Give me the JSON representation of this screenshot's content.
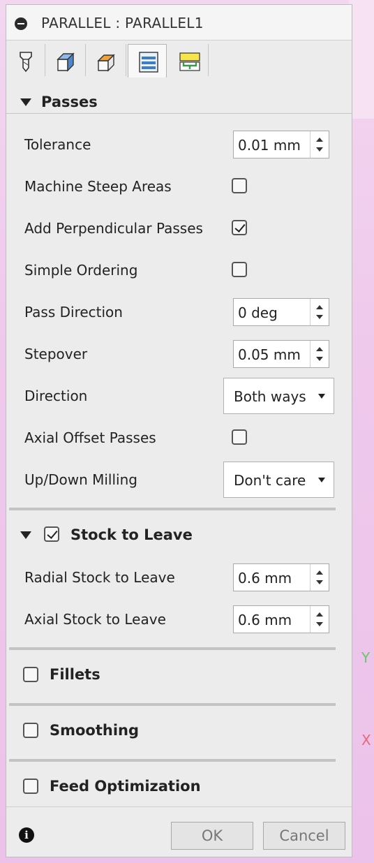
{
  "window": {
    "title": "PARALLEL : PARALLEL1"
  },
  "tabs": [
    {
      "icon": "tool-icon"
    },
    {
      "icon": "geometry-icon"
    },
    {
      "icon": "heights-icon"
    },
    {
      "icon": "passes-icon",
      "active": true
    },
    {
      "icon": "linking-icon"
    }
  ],
  "passes": {
    "header": "Passes",
    "tolerance": {
      "label": "Tolerance",
      "value": "0.01 mm"
    },
    "machine_steep_areas": {
      "label": "Machine Steep Areas",
      "checked": false
    },
    "add_perpendicular_passes": {
      "label": "Add Perpendicular Passes",
      "checked": true
    },
    "simple_ordering": {
      "label": "Simple Ordering",
      "checked": false
    },
    "pass_direction": {
      "label": "Pass Direction",
      "value": "0 deg"
    },
    "stepover": {
      "label": "Stepover",
      "value": "0.05 mm"
    },
    "direction": {
      "label": "Direction",
      "value": "Both ways"
    },
    "axial_offset_passes": {
      "label": "Axial Offset Passes",
      "checked": false
    },
    "up_down_milling": {
      "label": "Up/Down Milling",
      "value": "Don't care"
    }
  },
  "stock_to_leave": {
    "header": "Stock to Leave",
    "checked": true,
    "radial": {
      "label": "Radial Stock to Leave",
      "value": "0.6 mm"
    },
    "axial": {
      "label": "Axial Stock to Leave",
      "value": "0.6 mm"
    }
  },
  "fillets": {
    "header": "Fillets",
    "checked": false
  },
  "smoothing": {
    "header": "Smoothing",
    "checked": false
  },
  "feed_optimization": {
    "header": "Feed Optimization",
    "checked": false
  },
  "footer": {
    "ok_label": "OK",
    "cancel_label": "Cancel"
  },
  "viewport": {
    "axis_y": "Y",
    "axis_x": "X"
  },
  "colors": {
    "panel_bg": "#ececec",
    "canvas_bg": "#efc9ec",
    "button_text": "#777777"
  }
}
